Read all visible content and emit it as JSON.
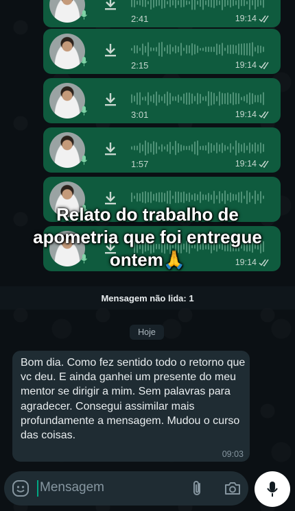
{
  "voice_messages": [
    {
      "duration": "2:41",
      "time": "19:14"
    },
    {
      "duration": "2:15",
      "time": "19:14"
    },
    {
      "duration": "3:01",
      "time": "19:14"
    },
    {
      "duration": "1:57",
      "time": "19:14"
    },
    {
      "duration": "",
      "time": ""
    },
    {
      "duration": "",
      "time": "19:14"
    }
  ],
  "overlay": {
    "line1": "Relato do trabalho de",
    "line2": "apometria que foi entregue",
    "line3": "ontem🙏"
  },
  "unread_banner": "Mensagem não lida: 1",
  "date_chip": "Hoje",
  "incoming_message": {
    "text": "Bom dia. Como fez sentido todo o retorno que vc deu. E ainda ganhei um presente do meu mentor se dirigir a mim. Sem palavras para agradecer. Consegui assimilar mais profundamente a mensagem. Mudou o curso das coisas.",
    "time": "09:03"
  },
  "composer": {
    "placeholder": "Mensagem"
  },
  "colors": {
    "outgoing_bubble": "#0f5b3e",
    "incoming_bubble": "#1f2c33",
    "background": "#0b1014",
    "read_ticks": "#c6d7cf"
  },
  "icons": [
    "download-icon",
    "mic-icon",
    "double-check-icon",
    "emoji-icon",
    "attach-icon",
    "camera-icon"
  ]
}
